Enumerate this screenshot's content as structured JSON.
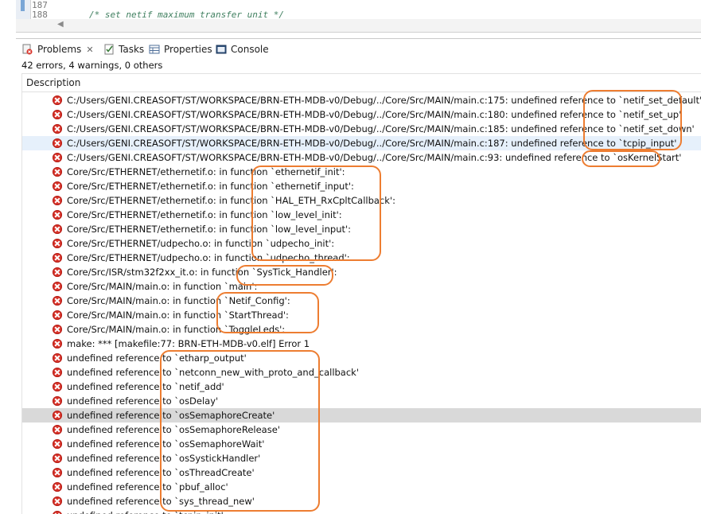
{
  "editor": {
    "line_numbers": [
      "187",
      "188"
    ],
    "code_line": "/* set netif maximum transfer unit */"
  },
  "tabs": [
    {
      "label": "Problems",
      "icon": "problems-icon",
      "close": "✕"
    },
    {
      "label": "Tasks",
      "icon": "tasks-icon"
    },
    {
      "label": "Properties",
      "icon": "properties-icon"
    },
    {
      "label": "Console",
      "icon": "console-icon"
    }
  ],
  "summary": "42 errors, 4 warnings, 0 others",
  "column_header": "Description",
  "errors": [
    "C:/Users/GENI.CREASOFT/ST/WORKSPACE/BRN-ETH-MDB-v0/Debug/../Core/Src/MAIN/main.c:175: undefined reference to `netif_set_default'",
    "C:/Users/GENI.CREASOFT/ST/WORKSPACE/BRN-ETH-MDB-v0/Debug/../Core/Src/MAIN/main.c:180: undefined reference to `netif_set_up'",
    "C:/Users/GENI.CREASOFT/ST/WORKSPACE/BRN-ETH-MDB-v0/Debug/../Core/Src/MAIN/main.c:185: undefined reference to `netif_set_down'",
    "C:/Users/GENI.CREASOFT/ST/WORKSPACE/BRN-ETH-MDB-v0/Debug/../Core/Src/MAIN/main.c:187: undefined reference to `tcpip_input'",
    "C:/Users/GENI.CREASOFT/ST/WORKSPACE/BRN-ETH-MDB-v0/Debug/../Core/Src/MAIN/main.c:93: undefined reference to `osKernelStart'",
    "Core/Src/ETHERNET/ethernetif.o: in function `ethernetif_init':",
    "Core/Src/ETHERNET/ethernetif.o: in function `ethernetif_input':",
    "Core/Src/ETHERNET/ethernetif.o: in function `HAL_ETH_RxCpltCallback':",
    "Core/Src/ETHERNET/ethernetif.o: in function `low_level_init':",
    "Core/Src/ETHERNET/ethernetif.o: in function `low_level_input':",
    "Core/Src/ETHERNET/udpecho.o: in function `udpecho_init':",
    "Core/Src/ETHERNET/udpecho.o: in function `udpecho_thread':",
    "Core/Src/ISR/stm32f2xx_it.o: in function `SysTick_Handler':",
    "Core/Src/MAIN/main.o: in function `main':",
    "Core/Src/MAIN/main.o: in function `Netif_Config':",
    "Core/Src/MAIN/main.o: in function `StartThread':",
    "Core/Src/MAIN/main.o: in function `ToggleLeds':",
    "make: *** [makefile:77: BRN-ETH-MDB-v0.elf] Error 1",
    "undefined reference to `etharp_output'",
    "undefined reference to `netconn_new_with_proto_and_callback'",
    "undefined reference to `netif_add'",
    "undefined reference to `osDelay'",
    "undefined reference to `osSemaphoreCreate'",
    "undefined reference to `osSemaphoreRelease'",
    "undefined reference to `osSemaphoreWait'",
    "undefined reference to `osSystickHandler'",
    "undefined reference to `osThreadCreate'",
    "undefined reference to `pbuf_alloc'",
    "undefined reference to `sys_thread_new'",
    "undefined reference to `tcpip_init'"
  ],
  "selected_rows": {
    "light": 3,
    "gray": 22
  },
  "colors": {
    "error": "#d9342b",
    "annotation": "#ed7d31",
    "selection_light": "#e6f0fb",
    "selection_gray": "#d9d9d9"
  }
}
